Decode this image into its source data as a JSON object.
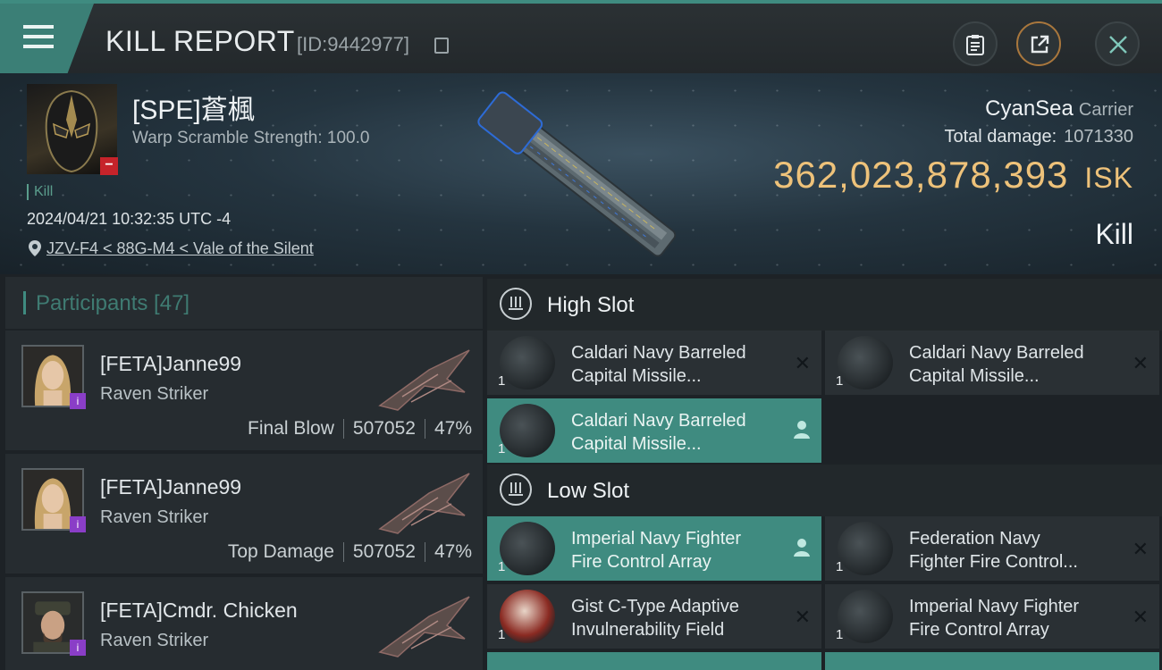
{
  "header": {
    "title": "KILL REPORT",
    "id_label": "[ID:9442977]"
  },
  "hero": {
    "victim_name": "[SPE]蒼楓",
    "warp_scramble": "Warp Scramble Strength: 100.0",
    "kill_tag": "Kill",
    "datetime": "2024/04/21 10:32:35 UTC -4",
    "location": "JZV-F4 < 88G-M4 < Vale of the Silent",
    "corp": "CyanSea",
    "ship_type": "Carrier",
    "total_damage_label": "Total damage:",
    "total_damage": "1071330",
    "isk_value": "362,023,878,393",
    "isk_unit": "ISK",
    "result": "Kill"
  },
  "participants": {
    "title": "Participants [47]",
    "rows": [
      {
        "name": "[FETA]Janne99",
        "ship": "Raven Striker",
        "role": "Final Blow",
        "damage": "507052",
        "percent": "47%"
      },
      {
        "name": "[FETA]Janne99",
        "ship": "Raven Striker",
        "role": "Top Damage",
        "damage": "507052",
        "percent": "47%"
      },
      {
        "name": "[FETA]Cmdr. Chicken",
        "ship": "Raven Striker",
        "role": "",
        "damage": "",
        "percent": ""
      }
    ]
  },
  "slots": {
    "high_title": "High Slot",
    "low_title": "Low Slot",
    "high": [
      {
        "line1": "Caldari Navy Barreled",
        "line2": "Capital Missile...",
        "qty": "1",
        "state": "destroyed"
      },
      {
        "line1": "Caldari Navy Barreled",
        "line2": "Capital Missile...",
        "qty": "1",
        "state": "destroyed"
      },
      {
        "line1": "Caldari Navy Barreled",
        "line2": "Capital Missile...",
        "qty": "1",
        "state": "dropped"
      }
    ],
    "low": [
      {
        "line1": "Imperial Navy Fighter",
        "line2": "Fire Control Array",
        "qty": "1",
        "state": "dropped"
      },
      {
        "line1": "Federation Navy",
        "line2": "Fighter Fire Control...",
        "qty": "1",
        "state": "destroyed"
      },
      {
        "line1": "Gist C-Type Adaptive",
        "line2": "Invulnerability Field",
        "qty": "1",
        "state": "destroyed"
      },
      {
        "line1": "Imperial Navy Fighter",
        "line2": "Fire Control Array",
        "qty": "1",
        "state": "destroyed"
      }
    ]
  },
  "colors": {
    "accent": "#3f8b80",
    "isk": "#eec27a",
    "danger": "#c6232a",
    "purple": "#8a3ec7"
  },
  "icons": {
    "menu": "hamburger-menu-icon",
    "clipboard": "clipboard-icon",
    "share": "share-icon",
    "close": "close-icon",
    "pin": "location-pin-icon"
  }
}
